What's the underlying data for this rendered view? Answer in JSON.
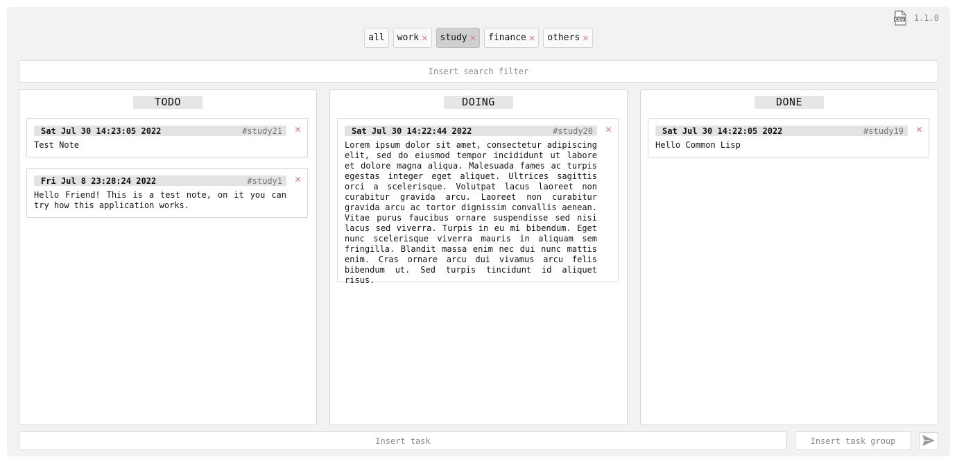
{
  "header": {
    "version": "1.1.0",
    "csv_icon_name": "csv-file-icon"
  },
  "tabs": [
    {
      "label": "all",
      "closable": false,
      "active": false
    },
    {
      "label": "work",
      "closable": true,
      "active": false
    },
    {
      "label": "study",
      "closable": true,
      "active": true
    },
    {
      "label": "finance",
      "closable": true,
      "active": false
    },
    {
      "label": "others",
      "closable": true,
      "active": false
    }
  ],
  "search": {
    "placeholder": "Insert search filter",
    "value": ""
  },
  "columns": [
    {
      "title": "TODO",
      "cards": [
        {
          "date": "Sat Jul 30 14:23:05 2022",
          "tag": "#study21",
          "body": "Test Note"
        },
        {
          "date": "Fri Jul 8 23:28:24 2022",
          "tag": "#study1",
          "body": "Hello Friend! This is a test note, on it you can try how this application works."
        }
      ]
    },
    {
      "title": "DOING",
      "cards": [
        {
          "date": "Sat Jul 30 14:22:44 2022",
          "tag": "#study20",
          "body": "Lorem ipsum dolor sit amet, consectetur adipiscing elit, sed do eiusmod tempor incididunt ut labore et dolore magna aliqua. Malesuada fames ac turpis egestas integer eget aliquet. Ultrices sagittis orci a scelerisque. Volutpat lacus laoreet non curabitur gravida arcu. Laoreet non curabitur gravida arcu ac tortor dignissim convallis aenean. Vitae purus faucibus ornare suspendisse sed nisi lacus sed viverra. Turpis in eu mi bibendum. Eget nunc scelerisque viverra mauris in aliquam sem fringilla. Blandit massa enim nec dui nunc mattis enim. Cras ornare arcu dui vivamus arcu felis bibendum ut. Sed turpis tincidunt id aliquet risus."
        }
      ]
    },
    {
      "title": "DONE",
      "cards": [
        {
          "date": "Sat Jul 30 14:22:05 2022",
          "tag": "#study19",
          "body": "Hello Common Lisp"
        }
      ]
    }
  ],
  "footer": {
    "task_placeholder": "Insert task",
    "group_placeholder": "Insert task group",
    "send_icon_name": "send-icon"
  },
  "colors": {
    "close": "#e07a7a",
    "panel": "#f2f2f2",
    "active_tab": "#cfcfcf"
  }
}
